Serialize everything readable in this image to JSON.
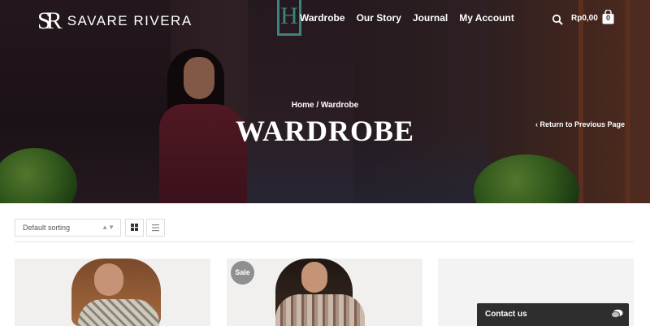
{
  "brand": {
    "monogram": "SR",
    "name": "SAVARE RIVERA"
  },
  "nav": {
    "items": [
      {
        "label": "Wardrobe"
      },
      {
        "label": "Our Story"
      },
      {
        "label": "Journal"
      },
      {
        "label": "My Account"
      }
    ],
    "cart_total": "Rp0,00",
    "cart_count": "0"
  },
  "hero": {
    "sign_letter": "H",
    "breadcrumb": "Home / Wardrobe",
    "title": "WARDROBE",
    "return_link": "‹ Return to Previous Page"
  },
  "toolbar": {
    "sort_value": "Default sorting",
    "sort_caret": "▲▼"
  },
  "products": {
    "sale_badge": "Sale"
  },
  "chat": {
    "label": "Contact us"
  },
  "colors": {
    "accent": "#4fb8ae",
    "sale_badge": "#8f8f8f",
    "chat_bar": "#2e2e2e"
  },
  "icons": [
    "search-icon",
    "cart-icon",
    "grid-view-icon",
    "list-view-icon",
    "chat-icon"
  ]
}
